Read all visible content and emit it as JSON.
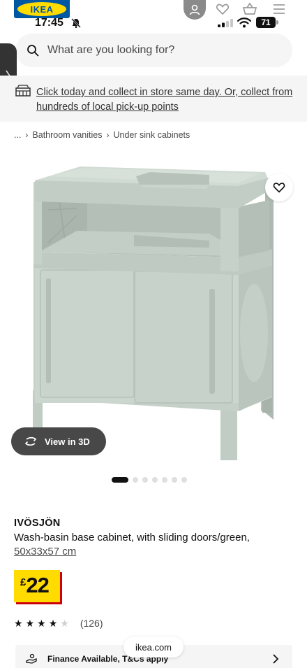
{
  "status_bar": {
    "time": "17:45",
    "battery": "71"
  },
  "header": {
    "logo_text": "IKEA",
    "icons": [
      "avatar-icon",
      "heart-icon",
      "basket-icon",
      "menu-icon"
    ]
  },
  "search": {
    "placeholder": "What are you looking for?"
  },
  "banner": {
    "text": "Click today and collect in store same day. Or, collect from hundreds of local pick-up points"
  },
  "breadcrumb": {
    "items": [
      "...",
      "Bathroom vanities",
      "Under sink cabinets"
    ]
  },
  "gallery": {
    "view_3d_label": "View in 3D",
    "image_count": 7,
    "active_index": 0,
    "product_color": "#c9d4cc"
  },
  "product": {
    "name": "IVÖSJÖN",
    "description": "Wash-basin base cabinet, with sliding doors/green,",
    "size": "50x33x57 cm",
    "currency": "£",
    "price": "22",
    "rating": 4,
    "rating_max": 5,
    "review_count": "(126)"
  },
  "footer": {
    "domain": "ikea.com",
    "finance_label": "Finance Available, T&Cs apply"
  },
  "colors": {
    "ikea_blue": "#0058a3",
    "ikea_yellow": "#ffdb00",
    "price_shadow_red": "#cc0008"
  }
}
